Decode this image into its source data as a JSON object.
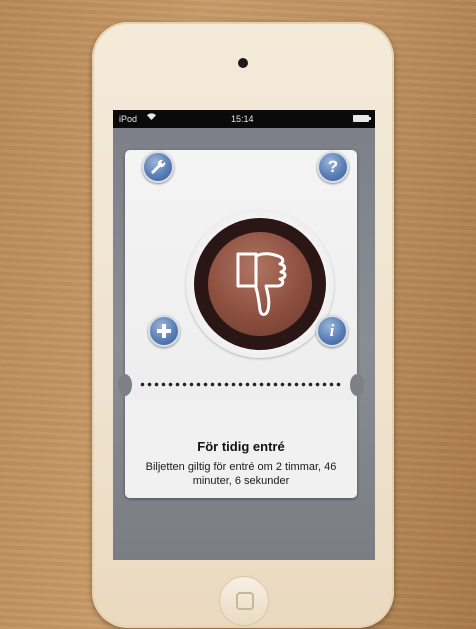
{
  "statusbar": {
    "carrier": "iPod",
    "time": "15:14",
    "wifi_icon": "wifi-icon",
    "battery_icon": "battery-icon"
  },
  "ticket": {
    "status_icon": "thumbs-down-icon",
    "title": "För tidig entré",
    "description": "Biljetten giltig för entré om 2 timmar, 46 minuter, 6 sekunder"
  },
  "buttons": {
    "settings_icon": "wrench-icon",
    "help_label": "?",
    "add_icon": "plus-icon",
    "info_label": "i"
  },
  "colors": {
    "button_blue": "#5a7fb6",
    "badge_brown": "#8c4f3f",
    "badge_ring_dark": "#2a1715"
  }
}
